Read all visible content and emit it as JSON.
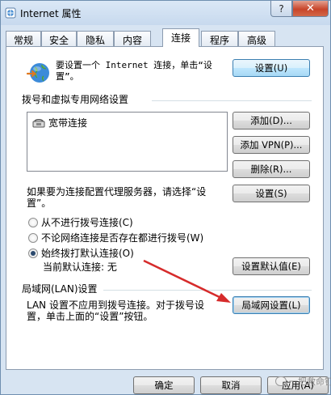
{
  "window": {
    "title": "Internet 属性",
    "help_glyph": "?",
    "close_glyph": "✕"
  },
  "tabs": [
    "常规",
    "安全",
    "隐私",
    "内容",
    "连接",
    "程序",
    "高级"
  ],
  "active_tab": "连接",
  "setup": {
    "text": "要设置一个 Internet 连接，单击“设\n置”。",
    "button": "设置(U)"
  },
  "dialup": {
    "heading": "拨号和虚拟专用网络设置",
    "items": [
      "宽带连接"
    ],
    "add_button": "添加(D)...",
    "add_vpn_button": "添加 VPN(P)...",
    "remove_button": "删除(R)...",
    "proxy_text": "如果要为连接配置代理服务器，请选择“设\n置”。",
    "settings_button": "设置(S)",
    "radios": [
      {
        "label": "从不进行拨号连接(C)",
        "checked": false
      },
      {
        "label": "不论网络连接是否存在都进行拨号(W)",
        "checked": false
      },
      {
        "label": "始终拨打默认连接(O)",
        "checked": true
      }
    ],
    "current_default_label": "当前默认连接:",
    "current_default_value": "无",
    "set_default_button": "设置默认值(E)"
  },
  "lan": {
    "heading": "局域网(LAN)设置",
    "text": "LAN 设置不应用到拨号连接。对于拨号设\n置，单击上面的“设置”按钮。",
    "button": "局域网设置(L)"
  },
  "footer": {
    "ok": "确定",
    "cancel": "取消",
    "apply": "应用(A)"
  },
  "watermark": "一把救命钉",
  "colors": {
    "arrow": "#d62b2b",
    "close_button": "#c8452a"
  }
}
